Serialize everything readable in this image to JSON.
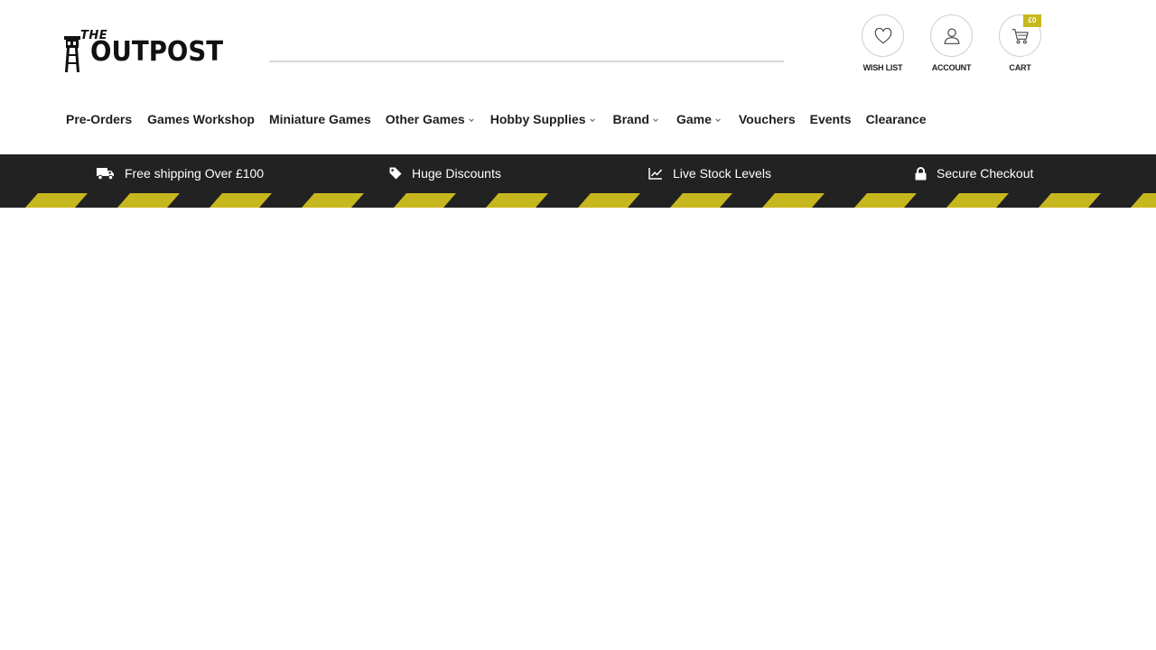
{
  "brand": {
    "logo_the": "THE",
    "logo_main": "OUTPOST",
    "accent_color": "#c7b71e",
    "bar_color": "#222222"
  },
  "search": {
    "value": "",
    "placeholder": ""
  },
  "header_actions": {
    "wishlist": {
      "label": "WISH LIST",
      "icon": "heart-icon"
    },
    "account": {
      "label": "ACCOUNT",
      "icon": "user-icon"
    },
    "cart": {
      "label": "CART",
      "icon": "cart-icon",
      "badge": "£0"
    }
  },
  "nav": {
    "items": [
      {
        "label": "Pre-Orders",
        "has_dropdown": false
      },
      {
        "label": "Games Workshop",
        "has_dropdown": false
      },
      {
        "label": "Miniature Games",
        "has_dropdown": false
      },
      {
        "label": "Other Games",
        "has_dropdown": true
      },
      {
        "label": "Hobby Supplies",
        "has_dropdown": true
      },
      {
        "label": "Brand",
        "has_dropdown": true
      },
      {
        "label": "Game",
        "has_dropdown": true
      },
      {
        "label": "Vouchers",
        "has_dropdown": false
      },
      {
        "label": "Events",
        "has_dropdown": false
      },
      {
        "label": "Clearance",
        "has_dropdown": false
      }
    ]
  },
  "infobar": {
    "items": [
      {
        "label": "Free shipping Over £100",
        "icon": "truck-icon"
      },
      {
        "label": "Huge Discounts",
        "icon": "tag-icon"
      },
      {
        "label": "Live Stock Levels",
        "icon": "chart-line-icon"
      },
      {
        "label": "Secure Checkout",
        "icon": "lock-icon"
      }
    ]
  }
}
